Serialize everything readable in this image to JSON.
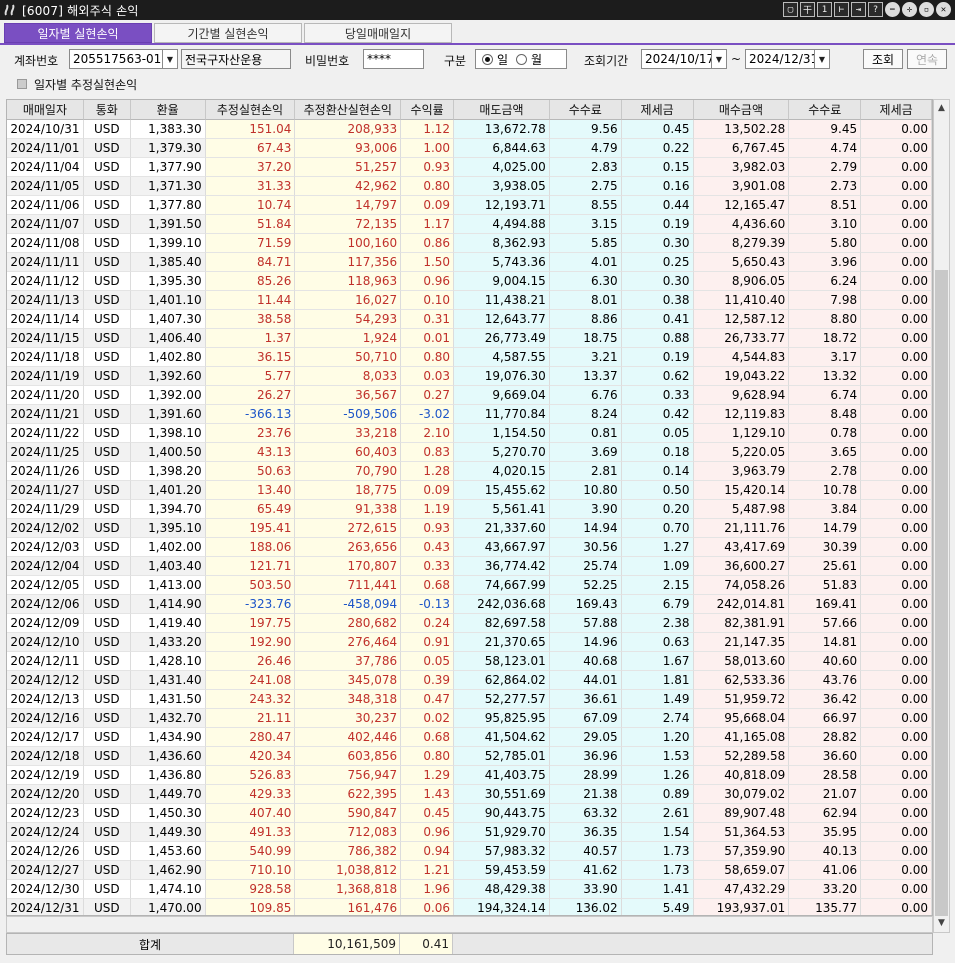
{
  "window": {
    "title": "[6007] 해외주식 손익"
  },
  "tabs": [
    {
      "label": "일자별 실현손익"
    },
    {
      "label": "기간별 실현손익"
    },
    {
      "label": "당일매매일지"
    }
  ],
  "form": {
    "account_label": "계좌번호",
    "account_value": "205517563-01",
    "account_name": "전국구자산운용",
    "password_label": "비밀번호",
    "password_value": "****",
    "type_label": "구분",
    "radio_day": "일",
    "radio_month": "월",
    "period_label": "조회기간",
    "date_from": "2024/10/17",
    "tilde": "~",
    "date_to": "2024/12/31",
    "query_button": "조회",
    "next_button": "연속",
    "checkbox_label": "일자별 추정실현손익"
  },
  "table": {
    "headers": [
      "매매일자",
      "통화",
      "환율",
      "추정실현손익",
      "추정환산실현손익",
      "수익률",
      "매도금액",
      "수수료",
      "제세금",
      "매수금액",
      "수수료",
      "제세금"
    ],
    "rows": [
      [
        "2024/10/31",
        "USD",
        "1,383.30",
        "151.04",
        "208,933",
        "1.12",
        "13,672.78",
        "9.56",
        "0.45",
        "13,502.28",
        "9.45",
        "0.00"
      ],
      [
        "2024/11/01",
        "USD",
        "1,379.30",
        "67.43",
        "93,006",
        "1.00",
        "6,844.63",
        "4.79",
        "0.22",
        "6,767.45",
        "4.74",
        "0.00"
      ],
      [
        "2024/11/04",
        "USD",
        "1,377.90",
        "37.20",
        "51,257",
        "0.93",
        "4,025.00",
        "2.83",
        "0.15",
        "3,982.03",
        "2.79",
        "0.00"
      ],
      [
        "2024/11/05",
        "USD",
        "1,371.30",
        "31.33",
        "42,962",
        "0.80",
        "3,938.05",
        "2.75",
        "0.16",
        "3,901.08",
        "2.73",
        "0.00"
      ],
      [
        "2024/11/06",
        "USD",
        "1,377.80",
        "10.74",
        "14,797",
        "0.09",
        "12,193.71",
        "8.55",
        "0.44",
        "12,165.47",
        "8.51",
        "0.00"
      ],
      [
        "2024/11/07",
        "USD",
        "1,391.50",
        "51.84",
        "72,135",
        "1.17",
        "4,494.88",
        "3.15",
        "0.19",
        "4,436.60",
        "3.10",
        "0.00"
      ],
      [
        "2024/11/08",
        "USD",
        "1,399.10",
        "71.59",
        "100,160",
        "0.86",
        "8,362.93",
        "5.85",
        "0.30",
        "8,279.39",
        "5.80",
        "0.00"
      ],
      [
        "2024/11/11",
        "USD",
        "1,385.40",
        "84.71",
        "117,356",
        "1.50",
        "5,743.36",
        "4.01",
        "0.25",
        "5,650.43",
        "3.96",
        "0.00"
      ],
      [
        "2024/11/12",
        "USD",
        "1,395.30",
        "85.26",
        "118,963",
        "0.96",
        "9,004.15",
        "6.30",
        "0.30",
        "8,906.05",
        "6.24",
        "0.00"
      ],
      [
        "2024/11/13",
        "USD",
        "1,401.10",
        "11.44",
        "16,027",
        "0.10",
        "11,438.21",
        "8.01",
        "0.38",
        "11,410.40",
        "7.98",
        "0.00"
      ],
      [
        "2024/11/14",
        "USD",
        "1,407.30",
        "38.58",
        "54,293",
        "0.31",
        "12,643.77",
        "8.86",
        "0.41",
        "12,587.12",
        "8.80",
        "0.00"
      ],
      [
        "2024/11/15",
        "USD",
        "1,406.40",
        "1.37",
        "1,924",
        "0.01",
        "26,773.49",
        "18.75",
        "0.88",
        "26,733.77",
        "18.72",
        "0.00"
      ],
      [
        "2024/11/18",
        "USD",
        "1,402.80",
        "36.15",
        "50,710",
        "0.80",
        "4,587.55",
        "3.21",
        "0.19",
        "4,544.83",
        "3.17",
        "0.00"
      ],
      [
        "2024/11/19",
        "USD",
        "1,392.60",
        "5.77",
        "8,033",
        "0.03",
        "19,076.30",
        "13.37",
        "0.62",
        "19,043.22",
        "13.32",
        "0.00"
      ],
      [
        "2024/11/20",
        "USD",
        "1,392.00",
        "26.27",
        "36,567",
        "0.27",
        "9,669.04",
        "6.76",
        "0.33",
        "9,628.94",
        "6.74",
        "0.00"
      ],
      [
        "2024/11/21",
        "USD",
        "1,391.60",
        "-366.13",
        "-509,506",
        "-3.02",
        "11,770.84",
        "8.24",
        "0.42",
        "12,119.83",
        "8.48",
        "0.00"
      ],
      [
        "2024/11/22",
        "USD",
        "1,398.10",
        "23.76",
        "33,218",
        "2.10",
        "1,154.50",
        "0.81",
        "0.05",
        "1,129.10",
        "0.78",
        "0.00"
      ],
      [
        "2024/11/25",
        "USD",
        "1,400.50",
        "43.13",
        "60,403",
        "0.83",
        "5,270.70",
        "3.69",
        "0.18",
        "5,220.05",
        "3.65",
        "0.00"
      ],
      [
        "2024/11/26",
        "USD",
        "1,398.20",
        "50.63",
        "70,790",
        "1.28",
        "4,020.15",
        "2.81",
        "0.14",
        "3,963.79",
        "2.78",
        "0.00"
      ],
      [
        "2024/11/27",
        "USD",
        "1,401.20",
        "13.40",
        "18,775",
        "0.09",
        "15,455.62",
        "10.80",
        "0.50",
        "15,420.14",
        "10.78",
        "0.00"
      ],
      [
        "2024/11/29",
        "USD",
        "1,394.70",
        "65.49",
        "91,338",
        "1.19",
        "5,561.41",
        "3.90",
        "0.20",
        "5,487.98",
        "3.84",
        "0.00"
      ],
      [
        "2024/12/02",
        "USD",
        "1,395.10",
        "195.41",
        "272,615",
        "0.93",
        "21,337.60",
        "14.94",
        "0.70",
        "21,111.76",
        "14.79",
        "0.00"
      ],
      [
        "2024/12/03",
        "USD",
        "1,402.00",
        "188.06",
        "263,656",
        "0.43",
        "43,667.97",
        "30.56",
        "1.27",
        "43,417.69",
        "30.39",
        "0.00"
      ],
      [
        "2024/12/04",
        "USD",
        "1,403.40",
        "121.71",
        "170,807",
        "0.33",
        "36,774.42",
        "25.74",
        "1.09",
        "36,600.27",
        "25.61",
        "0.00"
      ],
      [
        "2024/12/05",
        "USD",
        "1,413.00",
        "503.50",
        "711,441",
        "0.68",
        "74,667.99",
        "52.25",
        "2.15",
        "74,058.26",
        "51.83",
        "0.00"
      ],
      [
        "2024/12/06",
        "USD",
        "1,414.90",
        "-323.76",
        "-458,094",
        "-0.13",
        "242,036.68",
        "169.43",
        "6.79",
        "242,014.81",
        "169.41",
        "0.00"
      ],
      [
        "2024/12/09",
        "USD",
        "1,419.40",
        "197.75",
        "280,682",
        "0.24",
        "82,697.58",
        "57.88",
        "2.38",
        "82,381.91",
        "57.66",
        "0.00"
      ],
      [
        "2024/12/10",
        "USD",
        "1,433.20",
        "192.90",
        "276,464",
        "0.91",
        "21,370.65",
        "14.96",
        "0.63",
        "21,147.35",
        "14.81",
        "0.00"
      ],
      [
        "2024/12/11",
        "USD",
        "1,428.10",
        "26.46",
        "37,786",
        "0.05",
        "58,123.01",
        "40.68",
        "1.67",
        "58,013.60",
        "40.60",
        "0.00"
      ],
      [
        "2024/12/12",
        "USD",
        "1,431.40",
        "241.08",
        "345,078",
        "0.39",
        "62,864.02",
        "44.01",
        "1.81",
        "62,533.36",
        "43.76",
        "0.00"
      ],
      [
        "2024/12/13",
        "USD",
        "1,431.50",
        "243.32",
        "348,318",
        "0.47",
        "52,277.57",
        "36.61",
        "1.49",
        "51,959.72",
        "36.42",
        "0.00"
      ],
      [
        "2024/12/16",
        "USD",
        "1,432.70",
        "21.11",
        "30,237",
        "0.02",
        "95,825.95",
        "67.09",
        "2.74",
        "95,668.04",
        "66.97",
        "0.00"
      ],
      [
        "2024/12/17",
        "USD",
        "1,434.90",
        "280.47",
        "402,446",
        "0.68",
        "41,504.62",
        "29.05",
        "1.20",
        "41,165.08",
        "28.82",
        "0.00"
      ],
      [
        "2024/12/18",
        "USD",
        "1,436.60",
        "420.34",
        "603,856",
        "0.80",
        "52,785.01",
        "36.96",
        "1.53",
        "52,289.58",
        "36.60",
        "0.00"
      ],
      [
        "2024/12/19",
        "USD",
        "1,436.80",
        "526.83",
        "756,947",
        "1.29",
        "41,403.75",
        "28.99",
        "1.26",
        "40,818.09",
        "28.58",
        "0.00"
      ],
      [
        "2024/12/20",
        "USD",
        "1,449.70",
        "429.33",
        "622,395",
        "1.43",
        "30,551.69",
        "21.38",
        "0.89",
        "30,079.02",
        "21.07",
        "0.00"
      ],
      [
        "2024/12/23",
        "USD",
        "1,450.30",
        "407.40",
        "590,847",
        "0.45",
        "90,443.75",
        "63.32",
        "2.61",
        "89,907.48",
        "62.94",
        "0.00"
      ],
      [
        "2024/12/24",
        "USD",
        "1,449.30",
        "491.33",
        "712,083",
        "0.96",
        "51,929.70",
        "36.35",
        "1.54",
        "51,364.53",
        "35.95",
        "0.00"
      ],
      [
        "2024/12/26",
        "USD",
        "1,453.60",
        "540.99",
        "786,382",
        "0.94",
        "57,983.32",
        "40.57",
        "1.73",
        "57,359.90",
        "40.13",
        "0.00"
      ],
      [
        "2024/12/27",
        "USD",
        "1,462.90",
        "710.10",
        "1,038,812",
        "1.21",
        "59,453.59",
        "41.62",
        "1.73",
        "58,659.07",
        "41.06",
        "0.00"
      ],
      [
        "2024/12/30",
        "USD",
        "1,474.10",
        "928.58",
        "1,368,818",
        "1.96",
        "48,429.38",
        "33.90",
        "1.41",
        "47,432.29",
        "33.20",
        "0.00"
      ],
      [
        "2024/12/31",
        "USD",
        "1,470.00",
        "109.85",
        "161,476",
        "0.06",
        "194,324.14",
        "136.02",
        "5.49",
        "193,937.01",
        "135.77",
        "0.00"
      ]
    ]
  },
  "footer": {
    "total_label": "합계",
    "total_amount": "10,161,509",
    "total_rate": "0.41"
  },
  "colors": {
    "accent": "#7a4fc2",
    "positive": "#c0302a",
    "negative": "#1d55c8",
    "yellow_col": "#fffde6",
    "cyan_col": "#e4fafb",
    "pink_col": "#fdf0ef"
  },
  "icons": {
    "logo": "app-logo-icon",
    "window_buttons": [
      "restore-icon",
      "pin-icon",
      "one-icon",
      "link-icon",
      "export-icon",
      "help-icon",
      "minimize-icon",
      "move-icon",
      "maximize-icon",
      "close-icon"
    ]
  }
}
